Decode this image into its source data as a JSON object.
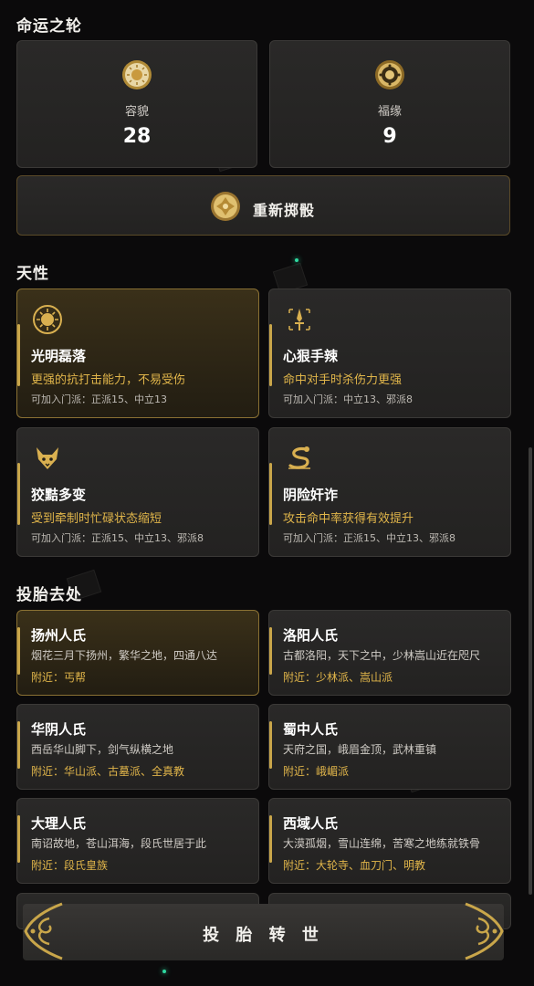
{
  "fate": {
    "title": "命运之轮",
    "stats": [
      {
        "label": "容貌",
        "value": "28",
        "icon": "sun-medal-icon"
      },
      {
        "label": "福缘",
        "value": "9",
        "icon": "compass-medal-icon"
      }
    ],
    "reroll_label": "重新掷骰"
  },
  "traits": {
    "title": "天性",
    "items": [
      {
        "name": "光明磊落",
        "desc": "更强的抗打击能力，不易受伤",
        "sects": "可加入门派：正派15、中立13",
        "icon": "sun-icon",
        "selected": true
      },
      {
        "name": "心狠手辣",
        "desc": "命中对手时杀伤力更强",
        "sects": "可加入门派：中立13、邪派8",
        "icon": "dagger-icon",
        "selected": false
      },
      {
        "name": "狡黠多变",
        "desc": "受到牵制时忙碌状态缩短",
        "sects": "可加入门派：正派15、中立13、邪派8",
        "icon": "fox-icon",
        "selected": false
      },
      {
        "name": "阴险奸诈",
        "desc": "攻击命中率获得有效提升",
        "sects": "可加入门派：正派15、中立13、邪派8",
        "icon": "snake-icon",
        "selected": false
      }
    ]
  },
  "origins": {
    "title": "投胎去处",
    "items": [
      {
        "name": "扬州人氏",
        "desc": "烟花三月下扬州，繁华之地，四通八达",
        "near": "附近：丐帮",
        "selected": true
      },
      {
        "name": "洛阳人氏",
        "desc": "古都洛阳，天下之中，少林嵩山近在咫尺",
        "near": "附近：少林派、嵩山派",
        "selected": false
      },
      {
        "name": "华阴人氏",
        "desc": "西岳华山脚下，剑气纵横之地",
        "near": "附近：华山派、古墓派、全真教",
        "selected": false
      },
      {
        "name": "蜀中人氏",
        "desc": "天府之国，峨眉金顶，武林重镇",
        "near": "附近：峨嵋派",
        "selected": false
      },
      {
        "name": "大理人氏",
        "desc": "南诏故地，苍山洱海，段氏世居于此",
        "near": "附近：段氏皇族",
        "selected": false
      },
      {
        "name": "西域人氏",
        "desc": "大漠孤烟，雪山连绵，苦寒之地练就铁骨",
        "near": "附近：大轮寺、血刀门、明教",
        "selected": false
      }
    ]
  },
  "reincarnate_label": "投 胎 转 世",
  "colors": {
    "accent": "#c9a64a",
    "accent_text": "#e0b54a",
    "particle": "#2ed8a0",
    "background": "#0b0a0b"
  }
}
